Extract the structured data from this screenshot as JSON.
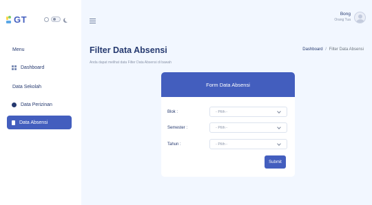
{
  "brand": {
    "logo_text": "GT",
    "accent": "#435ebe"
  },
  "user": {
    "name": "Bong",
    "role": "Orang Tua"
  },
  "sidebar": {
    "menu_title": "Menu",
    "items": [
      {
        "label": "Dashboard",
        "icon": "grid-icon"
      },
      {
        "label": "Data Perizinan",
        "icon": "circle-icon"
      },
      {
        "label": "Data Absensi",
        "icon": "file-icon",
        "active": true
      }
    ],
    "section_label": "Data Sekolah"
  },
  "page": {
    "title": "Filter Data Absensi",
    "subtitle": "Anda dapat melihat data Filter Data Absensi di bawah",
    "breadcrumb": {
      "home": "Dashboard",
      "separator": "/",
      "current": "Filter Data Absensi"
    }
  },
  "form": {
    "title": "Form Data Absensi",
    "fields": [
      {
        "label": "Blok :",
        "value": "- Pilih -"
      },
      {
        "label": "Semester :",
        "value": "- Pilih -"
      },
      {
        "label": "Tahun :",
        "value": "- Pilih -"
      }
    ],
    "submit_label": "Submit"
  }
}
